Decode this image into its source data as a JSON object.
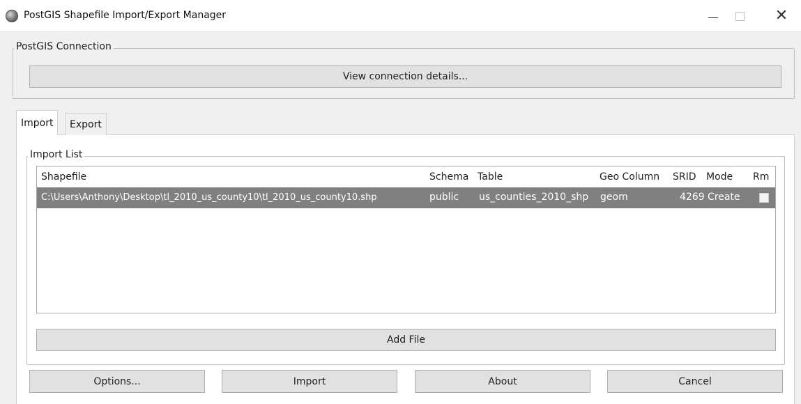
{
  "window": {
    "title": "PostGIS Shapefile Import/Export Manager",
    "controls": {
      "minimize": "—",
      "close": "✕"
    }
  },
  "connection": {
    "group_label": "PostGIS Connection",
    "view_details_label": "View connection details..."
  },
  "tabs": [
    {
      "label": "Import",
      "active": true
    },
    {
      "label": "Export",
      "active": false
    }
  ],
  "import_list": {
    "group_label": "Import List",
    "columns": [
      "Shapefile",
      "Schema",
      "Table",
      "Geo Column",
      "SRID",
      "Mode",
      "Rm"
    ],
    "rows": [
      {
        "shapefile": "C:\\Users\\Anthony\\Desktop\\tl_2010_us_county10\\tl_2010_us_county10.shp",
        "schema": "public",
        "table": "us_counties_2010_shp",
        "geo_column": "geom",
        "srid": "4269",
        "mode": "Create",
        "rm": false,
        "selected": true
      }
    ],
    "add_file_label": "Add File"
  },
  "buttons": {
    "options": "Options...",
    "import": "Import",
    "about": "About",
    "cancel": "Cancel"
  },
  "colors": {
    "selected_row": "#808080",
    "button_face": "#e1e1e1",
    "window_bg": "#f0f0f0"
  }
}
